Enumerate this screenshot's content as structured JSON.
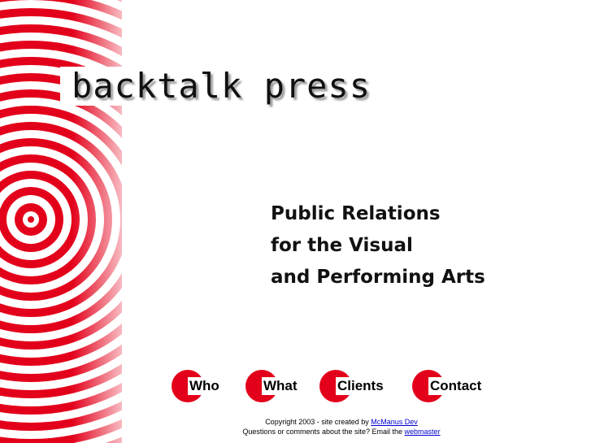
{
  "site": {
    "logo_text": "backtalk press"
  },
  "tagline": {
    "lines": [
      "Public Relations",
      "for the Visual",
      "and Performing Arts"
    ]
  },
  "nav": {
    "items": [
      {
        "label": "Who"
      },
      {
        "label": "What"
      },
      {
        "label": "Clients"
      },
      {
        "label": "Contact"
      }
    ]
  },
  "footer": {
    "copyright_text": "Copyright 2003 - site created by",
    "creator_link": "McManus Dev",
    "question_text": "Questions or comments about the site? Email the",
    "webmaster_link": "webmaster"
  },
  "colors": {
    "accent_red": "#e3001a",
    "background": "#ffffff",
    "link_blue": "#0000cc"
  }
}
